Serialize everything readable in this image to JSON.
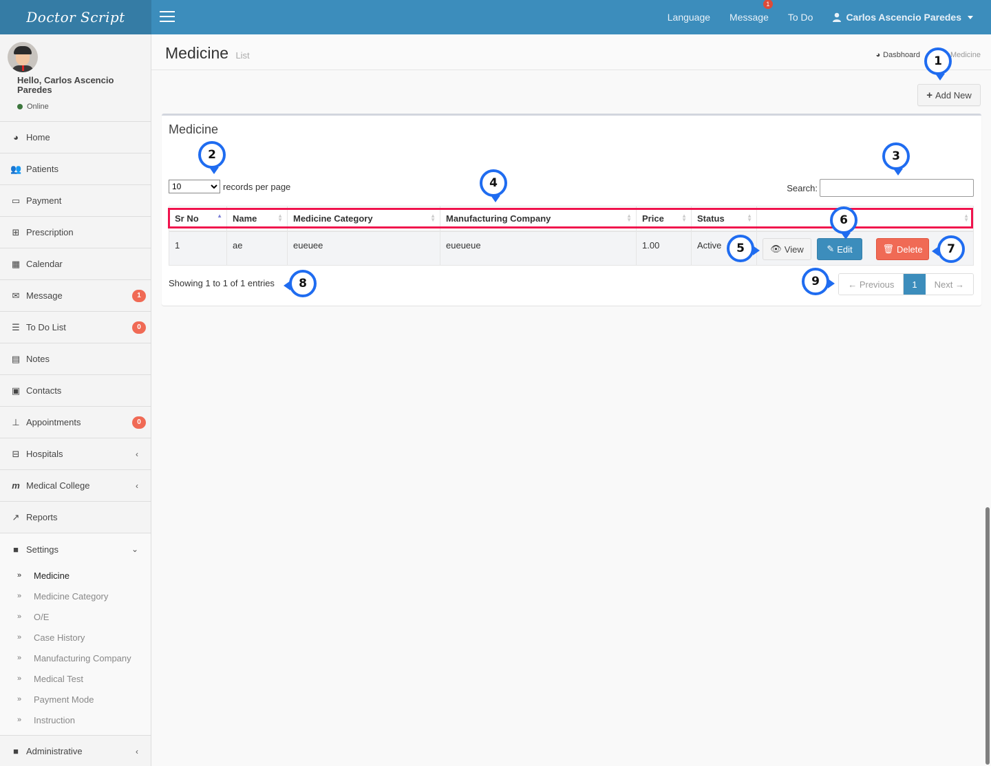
{
  "app": {
    "logo": "Doctor Script"
  },
  "topnav": {
    "language": "Language",
    "message": "Message",
    "message_badge": "1",
    "todo": "To Do",
    "user_name": "Carlos Ascencio Paredes"
  },
  "user_panel": {
    "greeting": "Hello, Carlos Ascencio Paredes",
    "status": "Online",
    "status_color": "#3c763d"
  },
  "sidebar": {
    "items": [
      {
        "label": "Home",
        "icon": "dashboard-icon"
      },
      {
        "label": "Patients",
        "icon": "users-icon"
      },
      {
        "label": "Payment",
        "icon": "credit-card-icon"
      },
      {
        "label": "Prescription",
        "icon": "medkit-icon"
      },
      {
        "label": "Calendar",
        "icon": "calendar-icon"
      },
      {
        "label": "Message",
        "icon": "envelope-icon",
        "badge": "1"
      },
      {
        "label": "To Do List",
        "icon": "list-icon",
        "badge": "0"
      },
      {
        "label": "Notes",
        "icon": "file-text-icon"
      },
      {
        "label": "Contacts",
        "icon": "address-card-icon"
      },
      {
        "label": "Appointments",
        "icon": "thumbtack-icon",
        "badge": "0"
      },
      {
        "label": "Hospitals",
        "icon": "hospital-icon"
      },
      {
        "label": "Medical College",
        "icon": "college-m-icon"
      },
      {
        "label": "Reports",
        "icon": "line-chart-icon"
      },
      {
        "label": "Settings",
        "icon": "folder-icon"
      },
      {
        "label": "Administrative",
        "icon": "folder-icon"
      }
    ],
    "settings_sub": [
      "Medicine",
      "Medicine Category",
      "O/E",
      "Case History",
      "Manufacturing Company",
      "Medical Test",
      "Payment Mode",
      "Instruction"
    ],
    "active_sub": "Medicine"
  },
  "header": {
    "title": "Medicine",
    "subtitle": "List",
    "breadcrumb": [
      "Dasbhoard",
      "Medicine"
    ]
  },
  "toolbar": {
    "add_new": "Add New"
  },
  "box": {
    "title": "Medicine",
    "length_value": "10",
    "length_label": "records per page",
    "search_label": "Search:",
    "search_value": ""
  },
  "table": {
    "columns": [
      "Sr No",
      "Name",
      "Medicine Category",
      "Manufacturing Company",
      "Price",
      "Status",
      ""
    ],
    "rows": [
      {
        "sr_no": "1",
        "name": "ae",
        "category": "eueuee",
        "company": "eueueue",
        "price": "1.00",
        "status": "Active"
      }
    ],
    "actions": {
      "view": "View",
      "edit": "Edit",
      "delete": "Delete"
    }
  },
  "footer": {
    "info": "Showing 1 to 1 of 1 entries",
    "prev": "← Previous",
    "page": "1",
    "next": "Next →"
  },
  "callouts": [
    "1",
    "2",
    "3",
    "4",
    "5",
    "6",
    "7",
    "8",
    "9"
  ],
  "colors": {
    "brand": "#3c8dbc",
    "brand_dark": "#357ca5",
    "danger": "#f06a55",
    "highlight": "#f0134d",
    "callout": "#1f6cf0"
  }
}
